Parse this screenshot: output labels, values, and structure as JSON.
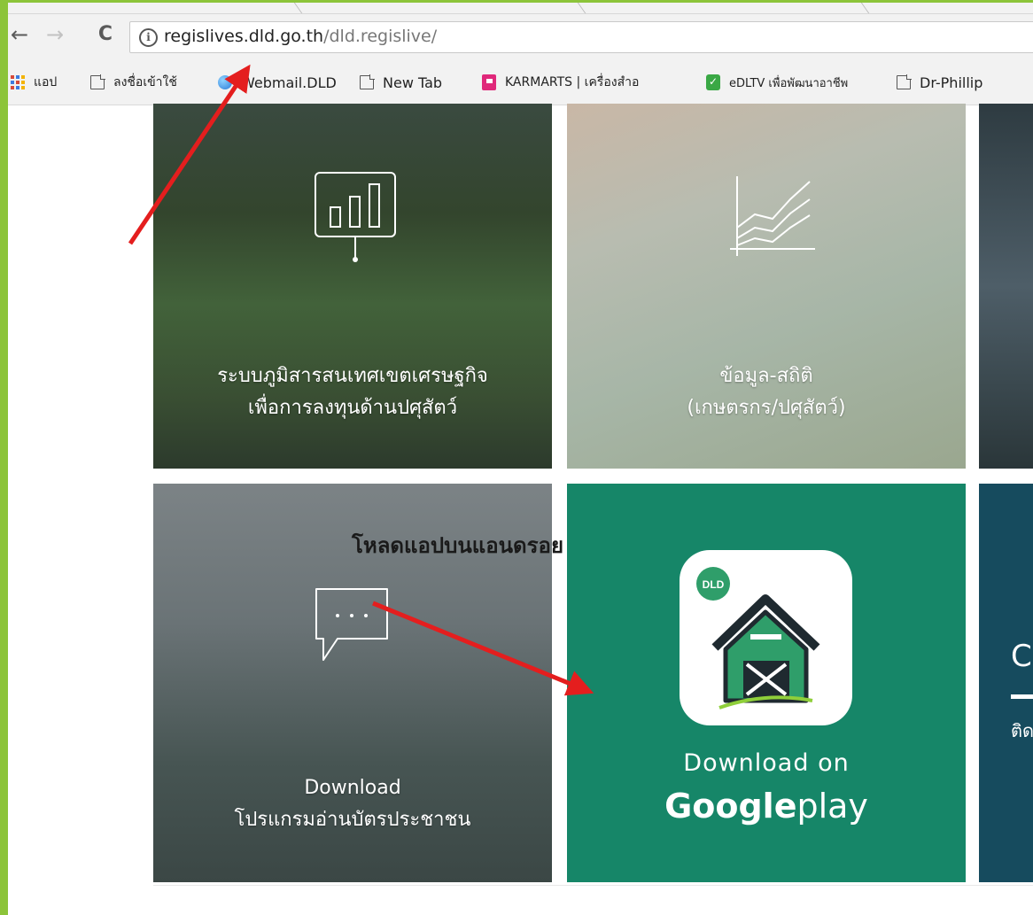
{
  "browser": {
    "url_host": "regislives.dld.go.th",
    "url_path": "/dld.regislive/",
    "back_icon": "←",
    "forward_icon": "→",
    "reload_icon": "C",
    "info_icon": "i",
    "bookmarks": [
      {
        "label": "แอป",
        "icon": "apps-icon"
      },
      {
        "label": "ลงชื่อเข้าใช้",
        "icon": "page-icon"
      },
      {
        "label": "Webmail.DLD",
        "icon": "globe-icon"
      },
      {
        "label": "New Tab",
        "icon": "page-icon"
      },
      {
        "label": "KARMARTS | เครื่องสำอ",
        "icon": "karmarts-icon"
      },
      {
        "label": "eDLTV เพื่อพัฒนาอาชีพ",
        "icon": "edltv-icon"
      },
      {
        "label": "Dr-Phillip",
        "icon": "page-icon"
      }
    ]
  },
  "tiles": {
    "economic": {
      "line1": "ระบบภูมิสารสนเทศเขตเศรษฐกิจ",
      "line2": "เพื่อการลงทุนด้านปศุสัตว์"
    },
    "statistics": {
      "line1": "ข้อมูล-สถิติ",
      "line2": "(เกษตรกร/ปศุสัตว์)"
    },
    "download": {
      "line1": "Download",
      "line2": "โปรแกรมอ่านบัตรประชาชน"
    },
    "googleplay": {
      "badge": "DLD",
      "line1": "Download on",
      "brand_bold": "Google",
      "brand_light": "play"
    },
    "contact": {
      "letter": "C",
      "text": "ติด"
    }
  },
  "annotation": {
    "text": "โหลดแอปบนแอนดรอย",
    "arrow_color": "#e41e1e"
  },
  "colors": {
    "frame": "#8cc43a",
    "googleplay_bg": "#168668",
    "contact_bg": "#164b5e",
    "app_green": "#2f9e6a"
  }
}
